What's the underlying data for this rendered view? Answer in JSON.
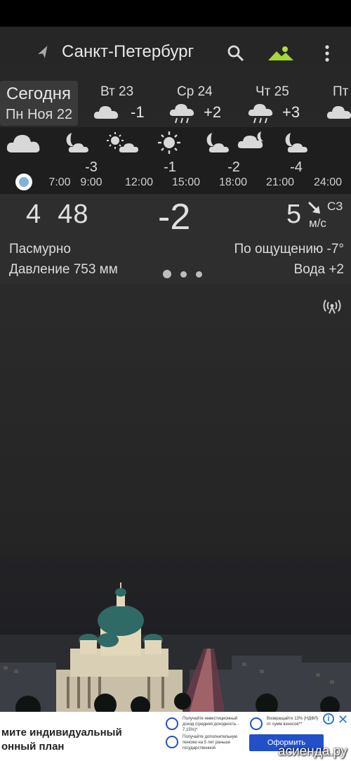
{
  "toolbar": {
    "city": "Санкт-Петербург",
    "icons": [
      "location-arrow-icon",
      "search-icon",
      "background-landscape-icon",
      "more-vert-icon"
    ],
    "accent": "#a6d63a"
  },
  "days": {
    "today": {
      "label": "Сегодня",
      "date": "Пн Ноя 22"
    },
    "list": [
      {
        "label": "Вт 23",
        "icon": "cloud-icon",
        "temp": "-1"
      },
      {
        "label": "Ср 24",
        "icon": "snow-cloud-icon",
        "temp": "+2"
      },
      {
        "label": "Чт 25",
        "icon": "snow-cloud-icon",
        "temp": "+3"
      },
      {
        "label": "Пт",
        "icon": "cloud-icon",
        "temp": ""
      }
    ]
  },
  "hourly": [
    {
      "time": "7:00",
      "icon": "cloud-icon",
      "temp": ""
    },
    {
      "time": "9:00",
      "icon": "moon-cloud-icon",
      "temp": "-3"
    },
    {
      "time": "12:00",
      "icon": "sun-cloud-icon",
      "temp": ""
    },
    {
      "time": "15:00",
      "icon": "sun-icon",
      "temp": "-1"
    },
    {
      "time": "18:00",
      "icon": "moon-cloud-icon",
      "temp": "-2"
    },
    {
      "time": "21:00",
      "icon": "moon-cloud-icon",
      "temp": "-4"
    },
    {
      "time": "24:00",
      "icon": "moon-cloud-icon",
      "temp": ""
    }
  ],
  "current": {
    "time": "4  48",
    "temp": "-2",
    "wind_speed": "5",
    "wind_dir": "СЗ",
    "wind_unit": "м/с",
    "condition": "Пасмурно",
    "feels_like": "По ощущению -7°",
    "pressure": "Давление 753 мм",
    "water": "Вода +2",
    "page_index": 0,
    "page_count": 3
  },
  "ad": {
    "headline_1": "мите индивидуальный",
    "headline_2": "онный план",
    "item1": "Получайте инвестиционный доход (средняя доходность - 7,15%)*",
    "item2": "Получайте дополнительную пенсию на 5 лет раньше государственной",
    "item3": "Возвращайте 13% (НДФЛ) от сумм взносов**",
    "button": "Оформить",
    "info": "i",
    "close": "✕"
  },
  "watermark": "асиенда.ру"
}
